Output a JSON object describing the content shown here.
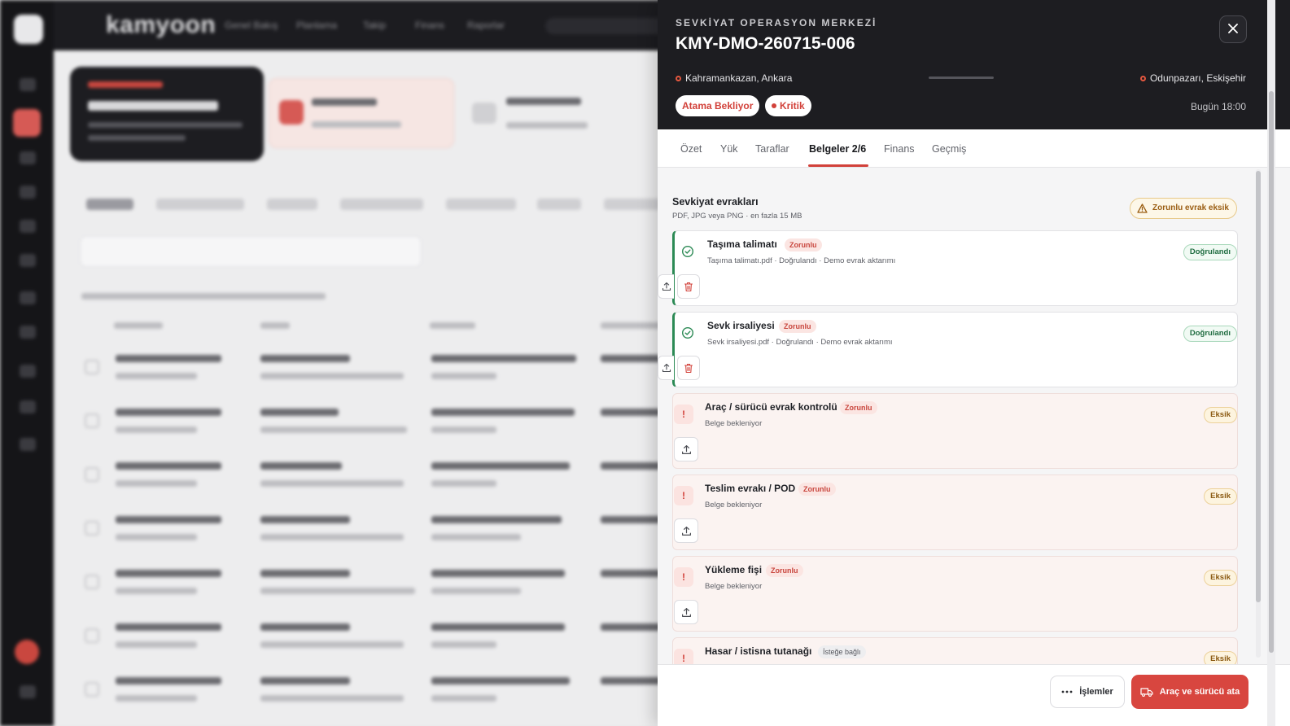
{
  "background": {
    "brand": "kamyoon",
    "nav": [
      "Genel Bakış",
      "Planlama",
      "Takip",
      "Finans",
      "Raporlar"
    ]
  },
  "drawer": {
    "eyebrow": "SEVKİYAT OPERASYON MERKEZİ",
    "title": "KMY-DMO-260715-006",
    "origin": "Kahramankazan, Ankara",
    "destination": "Odunpazarı, Eskişehir",
    "status_pill": "Atama Bekliyor",
    "priority_pill": "Kritik",
    "due": "Bugün 18:00",
    "close_icon": "close-icon",
    "tabs": [
      "Özet",
      "Yük",
      "Taraflar",
      "Belgeler 2/6",
      "Finans",
      "Geçmiş"
    ],
    "active_tab": "Belgeler 2/6",
    "section": {
      "title": "Sevkiyat evrakları",
      "subtitle": "PDF, JPG veya PNG · en fazla 15 MB",
      "warning": "Zorunlu evrak eksik"
    },
    "documents": [
      {
        "name": "Taşıma talimatı",
        "tag": "Zorunlu",
        "meta": "Taşıma talimatı.pdf · Doğrulandı · Demo evrak aktarımı",
        "status": "Doğrulandı"
      },
      {
        "name": "Sevk irsaliyesi",
        "tag": "Zorunlu",
        "meta": "Sevk irsaliyesi.pdf · Doğrulandı · Demo evrak aktarımı",
        "status": "Doğrulandı"
      },
      {
        "name": "Araç / sürücü evrak kontrolü",
        "tag": "Zorunlu",
        "meta": "Belge bekleniyor",
        "status": "Eksik"
      },
      {
        "name": "Teslim evrakı / POD",
        "tag": "Zorunlu",
        "meta": "Belge bekleniyor",
        "status": "Eksik"
      },
      {
        "name": "Yükleme fişi",
        "tag": "Zorunlu",
        "meta": "Belge bekleniyor",
        "status": "Eksik"
      },
      {
        "name": "Hasar / istisna tutanağı",
        "tag": "İsteğe bağlı",
        "meta": "",
        "status": "Eksik"
      }
    ],
    "footer": {
      "secondary": "İşlemler",
      "primary": "Araç ve sürücü ata"
    },
    "colors": {
      "accent": "#d8463f",
      "verified": "#2c8a55",
      "missing": "#d2413a"
    }
  }
}
